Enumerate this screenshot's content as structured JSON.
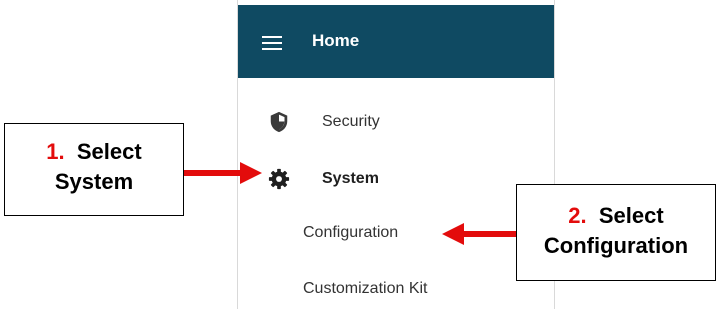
{
  "header": {
    "title": "Home"
  },
  "nav": {
    "items": [
      {
        "label": "Security",
        "icon": "shield-icon"
      },
      {
        "label": "System",
        "icon": "gear-icon"
      }
    ],
    "subitems": [
      {
        "label": "Configuration"
      },
      {
        "label": "Customization Kit"
      }
    ]
  },
  "callouts": {
    "step1": {
      "number": "1.",
      "line1": "Select",
      "line2": "System"
    },
    "step2": {
      "number": "2.",
      "line1": "Select",
      "line2": "Configuration"
    }
  },
  "colors": {
    "header_bg": "#0f4a62",
    "arrow": "#e30c0c",
    "step_number": "#e30c0c"
  }
}
